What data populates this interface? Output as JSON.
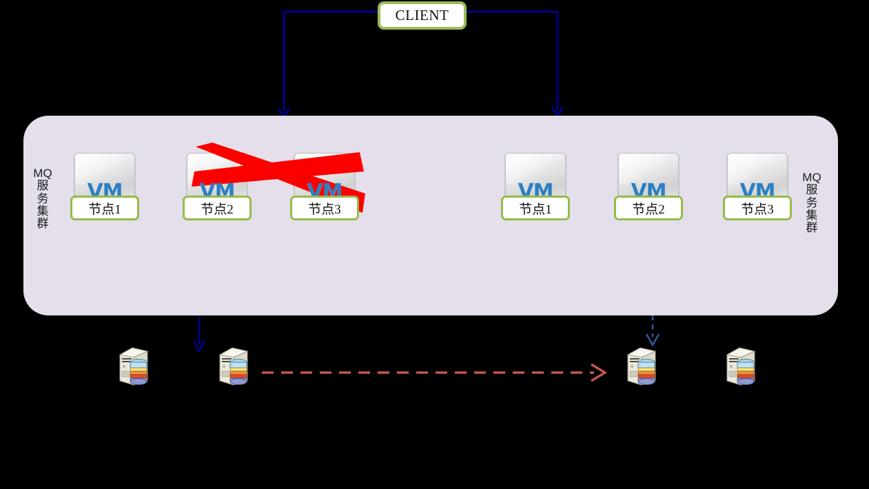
{
  "diagram": {
    "title_box": {
      "label": "CLIENT",
      "name": "client-box"
    },
    "colors": {
      "client_border": "#9bbb59",
      "panel_fill": "#e4dfeb",
      "node_border": "#94bb4a",
      "vm_text": "#2b7fc4",
      "arrow_blue": "#00008f",
      "cross_red": "#fc0000",
      "dashed_red": "#c0584f",
      "background": "#000000"
    },
    "left_cluster": {
      "caption_top": "MQ",
      "caption_chars": [
        "服",
        "务",
        "集",
        "群"
      ],
      "nodes": [
        {
          "vm": "VM",
          "label": "节点1"
        },
        {
          "vm": "VM",
          "label": "节点2"
        },
        {
          "vm": "VM",
          "label": "节点3"
        }
      ]
    },
    "right_cluster": {
      "caption_top": "MQ",
      "caption_chars": [
        "服",
        "务",
        "集",
        "群"
      ],
      "nodes": [
        {
          "vm": "VM",
          "label": "节点1"
        },
        {
          "vm": "VM",
          "label": "节点2"
        },
        {
          "vm": "VM",
          "label": "节点3"
        }
      ]
    },
    "failure_marker": {
      "name": "red-cross-over-node2-node3",
      "covers": [
        "节点2",
        "节点3"
      ]
    },
    "connectors": [
      {
        "name": "client-to-left-cluster",
        "style": "solid",
        "color": "#00008f",
        "direction": "down"
      },
      {
        "name": "client-to-right-cluster",
        "style": "solid",
        "color": "#00008f",
        "direction": "down"
      },
      {
        "name": "left-cluster-to-db",
        "style": "solid",
        "color": "#00008f",
        "direction": "down"
      },
      {
        "name": "right-cluster-to-db",
        "style": "dashed",
        "color": "#00008f",
        "direction": "down"
      },
      {
        "name": "db-replication",
        "style": "dashed",
        "color": "#c0584f",
        "direction": "right"
      }
    ],
    "servers": [
      {
        "name": "db-server-1"
      },
      {
        "name": "db-server-2"
      },
      {
        "name": "db-server-3"
      },
      {
        "name": "db-server-4"
      }
    ]
  }
}
